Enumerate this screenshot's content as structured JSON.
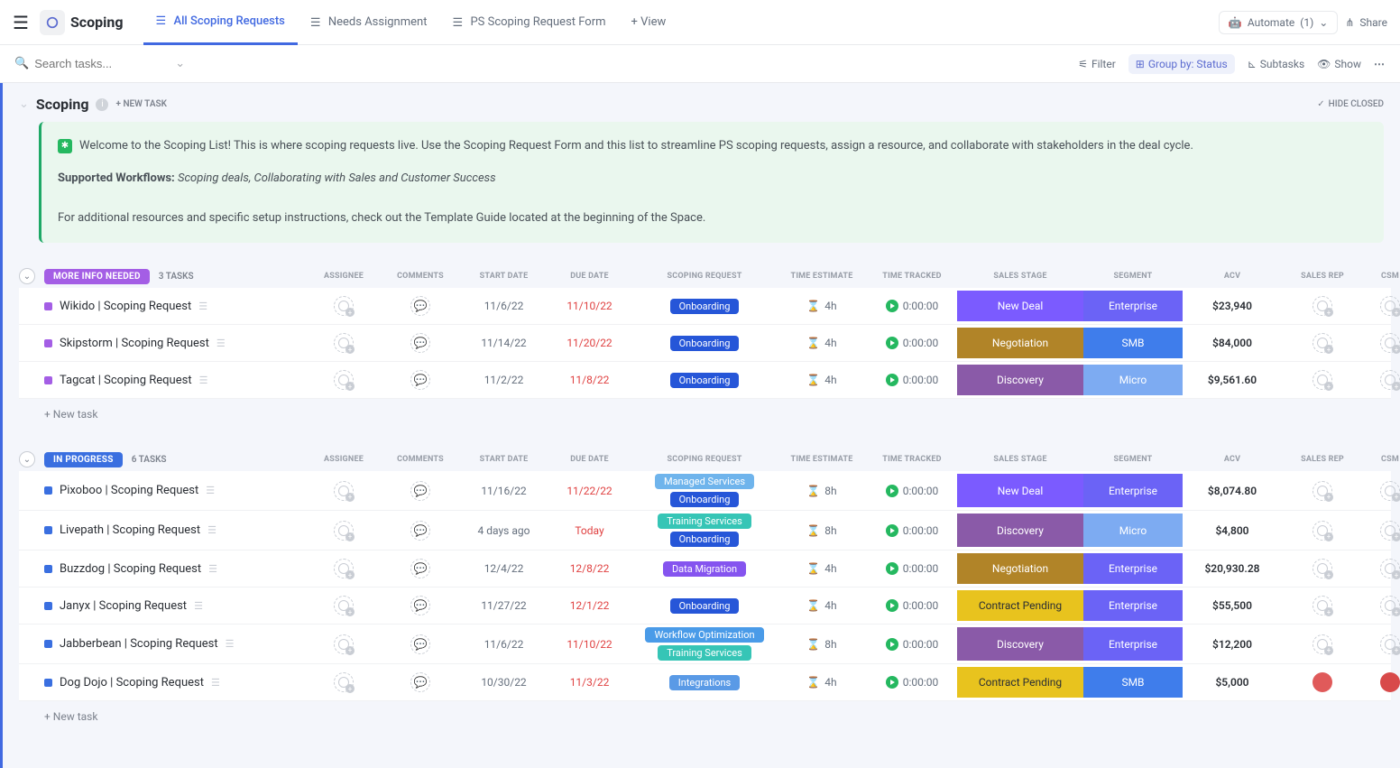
{
  "header": {
    "title": "Scoping",
    "tabs": [
      {
        "label": "All Scoping Requests",
        "active": true
      },
      {
        "label": "Needs Assignment",
        "active": false
      },
      {
        "label": "PS Scoping Request Form",
        "active": false
      }
    ],
    "add_view": "+ View",
    "automate": "Automate",
    "automate_count": "(1)",
    "share": "Share"
  },
  "toolbar": {
    "search_placeholder": "Search tasks...",
    "filter": "Filter",
    "group_by": "Group by: Status",
    "subtasks": "Subtasks",
    "show": "Show"
  },
  "scoping_title": "Scoping",
  "new_task_top": "+ NEW TASK",
  "hide_closed": "HIDE CLOSED",
  "banner": {
    "welcome": "Welcome to the Scoping List! This is where scoping requests live. Use the Scoping Request Form and this list to streamline PS scoping requests, assign a resource, and collaborate with stakeholders in the deal cycle.",
    "supported_label": "Supported Workflows:",
    "supported_text": "Scoping deals, Collaborating with Sales and Customer Success",
    "extra": "For additional resources and specific setup instructions, check out the Template Guide located at the beginning of the Space."
  },
  "columns": [
    "ASSIGNEE",
    "COMMENTS",
    "START DATE",
    "DUE DATE",
    "SCOPING REQUEST",
    "TIME ESTIMATE",
    "TIME TRACKED",
    "SALES STAGE",
    "SEGMENT",
    "ACV",
    "SALES REP",
    "CSM"
  ],
  "new_task_row": "+ New task",
  "colors": {
    "more_info": "#a45ee5",
    "in_progress": "#3a6fe0",
    "tag_onboarding": "#2656d8",
    "tag_managed": "#6fb4ec",
    "tag_training": "#36c5b6",
    "tag_datamig": "#8554ef",
    "tag_workflow": "#4a9be8",
    "tag_integrations": "#5a9ae6",
    "stage_newdeal": "#7b5bff",
    "stage_negotiation": "#b18428",
    "stage_discovery": "#8a5aa8",
    "stage_contract": "#e8c31e",
    "seg_enterprise": "#6b63f6",
    "seg_smb": "#3f7deb",
    "seg_micro": "#7dabf2"
  },
  "groups": [
    {
      "label": "MORE INFO NEEDED",
      "status_color": "more_info",
      "count": "3 TASKS",
      "rows": [
        {
          "name": "Wikido | Scoping Request",
          "start": "11/6/22",
          "due": "11/10/22",
          "due_red": true,
          "tags": [
            {
              "t": "Onboarding",
              "c": "tag_onboarding"
            }
          ],
          "est": "4h",
          "track": "0:00:00",
          "stage": {
            "t": "New Deal",
            "c": "stage_newdeal"
          },
          "seg": {
            "t": "Enterprise",
            "c": "seg_enterprise"
          },
          "acv": "$23,940"
        },
        {
          "name": "Skipstorm | Scoping Request",
          "start": "11/14/22",
          "due": "11/20/22",
          "due_red": true,
          "tags": [
            {
              "t": "Onboarding",
              "c": "tag_onboarding"
            }
          ],
          "est": "4h",
          "track": "0:00:00",
          "stage": {
            "t": "Negotiation",
            "c": "stage_negotiation"
          },
          "seg": {
            "t": "SMB",
            "c": "seg_smb"
          },
          "acv": "$84,000"
        },
        {
          "name": "Tagcat | Scoping Request",
          "start": "11/2/22",
          "due": "11/8/22",
          "due_red": true,
          "tags": [
            {
              "t": "Onboarding",
              "c": "tag_onboarding"
            }
          ],
          "est": "4h",
          "track": "0:00:00",
          "stage": {
            "t": "Discovery",
            "c": "stage_discovery"
          },
          "seg": {
            "t": "Micro",
            "c": "seg_micro"
          },
          "acv": "$9,561.60"
        }
      ]
    },
    {
      "label": "IN PROGRESS",
      "status_color": "in_progress",
      "count": "6 TASKS",
      "rows": [
        {
          "name": "Pixoboo | Scoping Request",
          "start": "11/16/22",
          "due": "11/22/22",
          "due_red": true,
          "tags": [
            {
              "t": "Managed Services",
              "c": "tag_managed"
            },
            {
              "t": "Onboarding",
              "c": "tag_onboarding"
            }
          ],
          "est": "8h",
          "track": "0:00:00",
          "stage": {
            "t": "New Deal",
            "c": "stage_newdeal"
          },
          "seg": {
            "t": "Enterprise",
            "c": "seg_enterprise"
          },
          "acv": "$8,074.80"
        },
        {
          "name": "Livepath | Scoping Request",
          "start": "4 days ago",
          "due": "Today",
          "due_red": true,
          "tags": [
            {
              "t": "Training Services",
              "c": "tag_training"
            },
            {
              "t": "Onboarding",
              "c": "tag_onboarding"
            }
          ],
          "est": "8h",
          "track": "0:00:00",
          "stage": {
            "t": "Discovery",
            "c": "stage_discovery"
          },
          "seg": {
            "t": "Micro",
            "c": "seg_micro"
          },
          "acv": "$4,800"
        },
        {
          "name": "Buzzdog | Scoping Request",
          "start": "12/4/22",
          "due": "12/8/22",
          "due_red": true,
          "tags": [
            {
              "t": "Data Migration",
              "c": "tag_datamig"
            }
          ],
          "est": "4h",
          "track": "0:00:00",
          "stage": {
            "t": "Negotiation",
            "c": "stage_negotiation"
          },
          "seg": {
            "t": "Enterprise",
            "c": "seg_enterprise"
          },
          "acv": "$20,930.28"
        },
        {
          "name": "Janyx | Scoping Request",
          "start": "11/27/22",
          "due": "12/1/22",
          "due_red": true,
          "tags": [
            {
              "t": "Onboarding",
              "c": "tag_onboarding"
            }
          ],
          "est": "4h",
          "track": "0:00:00",
          "stage": {
            "t": "Contract Pending",
            "c": "stage_contract",
            "dark": true
          },
          "seg": {
            "t": "Enterprise",
            "c": "seg_enterprise"
          },
          "acv": "$55,500"
        },
        {
          "name": "Jabberbean | Scoping Request",
          "start": "11/6/22",
          "due": "11/10/22",
          "due_red": true,
          "tags": [
            {
              "t": "Workflow Optimization",
              "c": "tag_workflow"
            },
            {
              "t": "Training Services",
              "c": "tag_training"
            }
          ],
          "est": "8h",
          "track": "0:00:00",
          "stage": {
            "t": "Discovery",
            "c": "stage_discovery"
          },
          "seg": {
            "t": "Enterprise",
            "c": "seg_enterprise"
          },
          "acv": "$12,200"
        },
        {
          "name": "Dog Dojo | Scoping Request",
          "start": "10/30/22",
          "due": "11/3/22",
          "due_red": true,
          "tags": [
            {
              "t": "Integrations",
              "c": "tag_integrations"
            }
          ],
          "est": "4h",
          "track": "0:00:00",
          "stage": {
            "t": "Contract Pending",
            "c": "stage_contract",
            "dark": true
          },
          "seg": {
            "t": "SMB",
            "c": "seg_smb"
          },
          "acv": "$5,000",
          "rep_avatar": "#e05a5a",
          "csm_avatar": "#d84a4a"
        }
      ]
    }
  ]
}
